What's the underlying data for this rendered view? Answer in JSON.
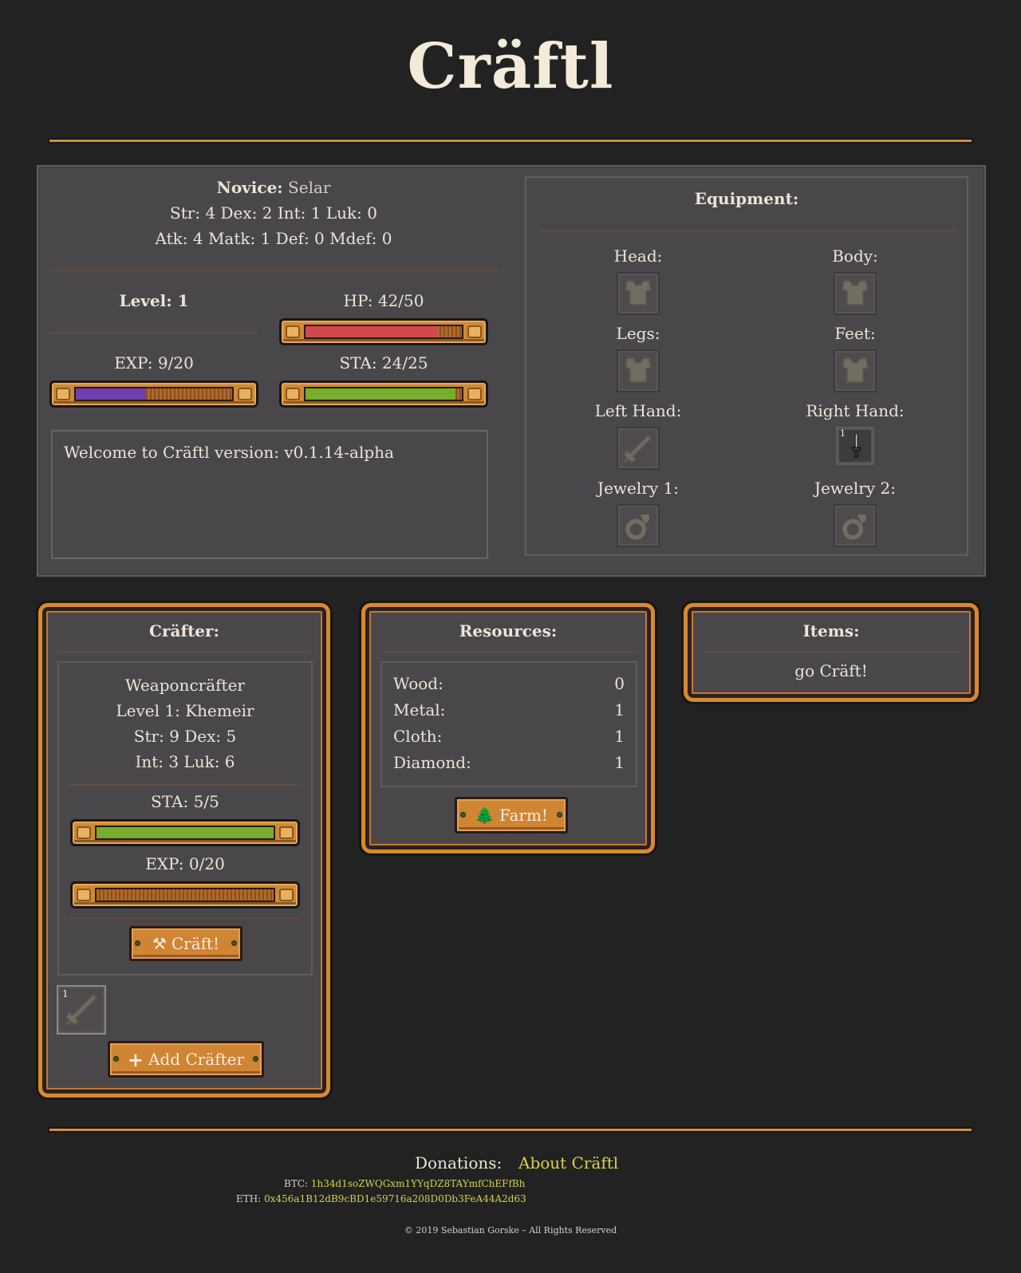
{
  "app": {
    "title": "Cräftl"
  },
  "player": {
    "class_label": "Novice:",
    "name": "Selar",
    "stats_line": "Str: 4 Dex: 2 Int: 1 Luk: 0",
    "combat_line": "Atk: 4 Matk: 1 Def: 0 Mdef: 0",
    "level_label": "Level: 1",
    "hp_label": "HP: 42/50",
    "hp_fraction": 0.84,
    "exp_label": "EXP: 9/20",
    "exp_fraction": 0.45,
    "sta_label": "STA: 24/25",
    "sta_fraction": 0.96
  },
  "log": {
    "message": "Welcome to Cräftl version: v0.1.14-alpha"
  },
  "equipment": {
    "title": "Equipment:",
    "slots": [
      {
        "label": "Head:",
        "icon": "armor-icon"
      },
      {
        "label": "Body:",
        "icon": "armor-icon"
      },
      {
        "label": "Legs:",
        "icon": "armor-icon"
      },
      {
        "label": "Feet:",
        "icon": "armor-icon"
      },
      {
        "label": "Left Hand:",
        "icon": "sword-icon"
      },
      {
        "label": "Right Hand:",
        "icon": "dagger-icon",
        "count": "1"
      },
      {
        "label": "Jewelry 1:",
        "icon": "ring-icon"
      },
      {
        "label": "Jewelry 2:",
        "icon": "ring-icon"
      }
    ]
  },
  "crafter": {
    "title": "Cräfter:",
    "type": "Weaponcräfter",
    "level_line": "Level 1: Khemeir",
    "stats_line1": "Str: 9 Dex: 5",
    "stats_line2": "Int: 3 Luk: 6",
    "sta_label": "STA: 5/5",
    "sta_fraction": 1.0,
    "exp_label": "EXP: 0/20",
    "exp_fraction": 0.0,
    "craft_button": "Cräft!",
    "inventory_count": "1",
    "add_button": "Add Cräfter"
  },
  "resources": {
    "title": "Resources:",
    "items": [
      {
        "name": "Wood:",
        "value": "0"
      },
      {
        "name": "Metal:",
        "value": "1"
      },
      {
        "name": "Cloth:",
        "value": "1"
      },
      {
        "name": "Diamond:",
        "value": "1"
      }
    ],
    "farm_button": "Farm!"
  },
  "items": {
    "title": "Items:",
    "link": "go Cräft!"
  },
  "footer": {
    "donations_label": "Donations:",
    "about_link": "About Cräftl",
    "btc_label": "BTC:",
    "btc_address": "1h34d1soZWQGxm1YYqDZ8TAYmfChEFfBh",
    "eth_label": "ETH:",
    "eth_address": "0x456a1B12dB9cBD1e59716a208D0Db3FeA44A2d63",
    "copyright": "© 2019 Sebastian Gorske – All Rights Reserved"
  },
  "colors": {
    "hp": "#d1494d",
    "exp": "#6e3fae",
    "sta": "#77ae2b",
    "frame": "#d58a2f",
    "link": "#d9d04a"
  }
}
